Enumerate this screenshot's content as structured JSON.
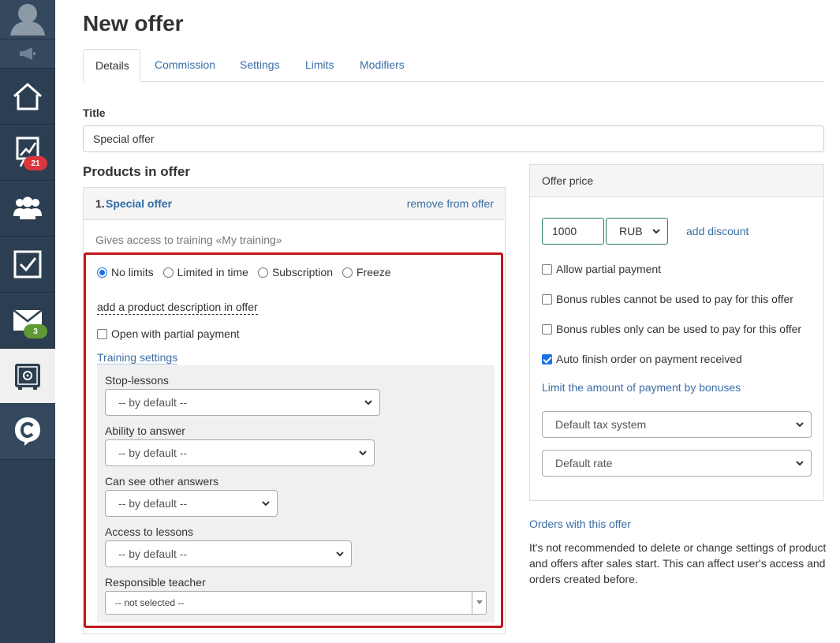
{
  "page": {
    "title": "New offer"
  },
  "tabs": [
    {
      "label": "Details",
      "active": true
    },
    {
      "label": "Commission",
      "active": false
    },
    {
      "label": "Settings",
      "active": false
    },
    {
      "label": "Limits",
      "active": false
    },
    {
      "label": "Modifiers",
      "active": false
    }
  ],
  "sidebar": {
    "items": [
      {
        "name": "avatar"
      },
      {
        "name": "notifications-speaker"
      },
      {
        "name": "home"
      },
      {
        "name": "sales-chart",
        "badge": "21"
      },
      {
        "name": "users"
      },
      {
        "name": "tasks"
      },
      {
        "name": "messages",
        "badge": "3"
      },
      {
        "name": "settings",
        "active": true
      },
      {
        "name": "getcourse-logo"
      }
    ]
  },
  "title_field": {
    "label": "Title",
    "value": "Special offer"
  },
  "products": {
    "heading": "Products in offer",
    "item": {
      "number": "1.",
      "name": "Special offer",
      "remove_label": "remove from offer",
      "description": "Gives access to training «My training»",
      "limit_options": [
        {
          "label": "No limits",
          "checked": true
        },
        {
          "label": "Limited in time",
          "checked": false
        },
        {
          "label": "Subscription",
          "checked": false
        },
        {
          "label": "Freeze",
          "checked": false
        }
      ],
      "add_description_label": "add a product description in offer",
      "partial_payment_label": "Open with partial payment",
      "training_settings_label": "Training settings",
      "training_settings": {
        "stop_lessons": {
          "label": "Stop-lessons",
          "value": "-- by default --"
        },
        "ability_to_answer": {
          "label": "Ability to answer",
          "value": "-- by default --"
        },
        "see_other_answers": {
          "label": "Can see other answers",
          "value": "-- by default --"
        },
        "access_to_lessons": {
          "label": "Access to lessons",
          "value": "-- by default --"
        },
        "responsible_teacher": {
          "label": "Responsible teacher",
          "value": "-- not selected --"
        }
      }
    }
  },
  "price": {
    "heading": "Offer price",
    "amount": "1000",
    "currency": "RUB",
    "add_discount_label": "add discount",
    "options": [
      {
        "label": "Allow partial payment",
        "checked": false
      },
      {
        "label": "Bonus rubles cannot be used to pay for this offer",
        "checked": false
      },
      {
        "label": "Bonus rubles only can be used to pay for this offer",
        "checked": false
      },
      {
        "label": "Auto finish order on payment received",
        "checked": true
      }
    ],
    "limit_bonus_link": "Limit the amount of payment by bonuses",
    "tax_system": "Default tax system",
    "rate": "Default rate"
  },
  "orders_link": "Orders with this offer",
  "warning_note": "It's not recommended to delete or change settings of product and offers after sales start. This can affect user's access and orders created before.",
  "colors": {
    "accent": "#3a6ea5",
    "highlight_border": "#c4161c",
    "sidebar_bg": "#2c3e51",
    "price_border": "#2a7d57"
  }
}
